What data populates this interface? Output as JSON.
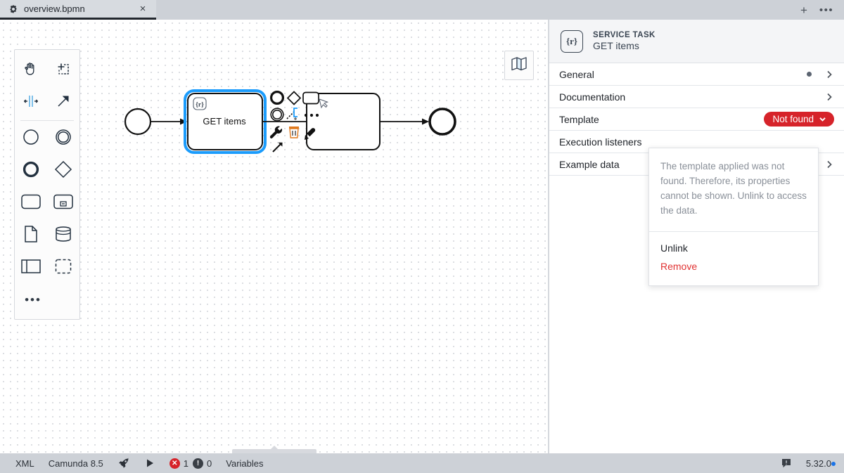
{
  "window": {
    "tab": {
      "title": "overview.bpmn",
      "icon": "gear-icon",
      "close_label": "×"
    },
    "toolbar": {
      "new_tab_label": "+",
      "more_label": "•••"
    }
  },
  "palette": {
    "items": [
      {
        "name": "hand-tool",
        "icon": "hand-icon"
      },
      {
        "name": "lasso-tool",
        "icon": "lasso-icon"
      },
      {
        "name": "space-tool",
        "icon": "space-tool-icon"
      },
      {
        "name": "global-connect-tool",
        "icon": "arrow-icon"
      },
      {
        "name": "create-start-event",
        "icon": "start-event-icon"
      },
      {
        "name": "create-intermediate-event",
        "icon": "intermediate-event-icon"
      },
      {
        "name": "create-end-event",
        "icon": "end-event-icon"
      },
      {
        "name": "create-gateway",
        "icon": "gateway-icon"
      },
      {
        "name": "create-task",
        "icon": "task-icon"
      },
      {
        "name": "create-subprocess",
        "icon": "subprocess-icon"
      },
      {
        "name": "create-data-object",
        "icon": "data-object-icon"
      },
      {
        "name": "create-data-store",
        "icon": "data-store-icon"
      },
      {
        "name": "create-participant",
        "icon": "participant-icon"
      },
      {
        "name": "create-group",
        "icon": "group-icon"
      }
    ],
    "more_label": "•••"
  },
  "canvas": {
    "minimap_toggle": "map-icon",
    "elements": {
      "start_event": {
        "name": "start-event"
      },
      "service_task": {
        "label": "GET items",
        "template_icon": "{r}"
      },
      "second_task": {
        "label": ""
      },
      "end_event": {
        "name": "end-event"
      }
    },
    "context_pad": [
      {
        "name": "append-end-event"
      },
      {
        "name": "append-gateway"
      },
      {
        "name": "append-task"
      },
      {
        "name": "append-intermediate-event"
      },
      {
        "name": "connect"
      },
      {
        "name": "more-options"
      },
      {
        "name": "change-type"
      },
      {
        "name": "delete"
      },
      {
        "name": "set-color"
      },
      {
        "name": "append-text-annotation"
      }
    ]
  },
  "properties": {
    "header": {
      "type": "SERVICE TASK",
      "name": "GET items",
      "icon": "{r}"
    },
    "groups": [
      {
        "label": "General",
        "has_dot": true,
        "chevron": "›"
      },
      {
        "label": "Documentation",
        "has_dot": false,
        "chevron": "›"
      },
      {
        "label": "Template",
        "has_dot": false,
        "badge": "Not found",
        "badge_color": "#d6232a"
      },
      {
        "label": "Execution listeners",
        "has_dot": false,
        "chevron": ""
      },
      {
        "label": "Example data",
        "has_dot": false,
        "chevron": "›"
      }
    ],
    "dropdown": {
      "message": "The template applied was not found. Therefore, its properties cannot be shown. Unlink to access the data.",
      "items": [
        {
          "label": "Unlink",
          "danger": false
        },
        {
          "label": "Remove",
          "danger": true
        }
      ]
    }
  },
  "statusbar": {
    "xml_label": "XML",
    "engine_label": "Camunda 8.5",
    "deploy_icon": "rocket-icon",
    "run_icon": "play-icon",
    "error_count": "1",
    "warning_count": "0",
    "variables_label": "Variables",
    "feedback_icon": "feedback-icon",
    "version": "5.32.0"
  }
}
